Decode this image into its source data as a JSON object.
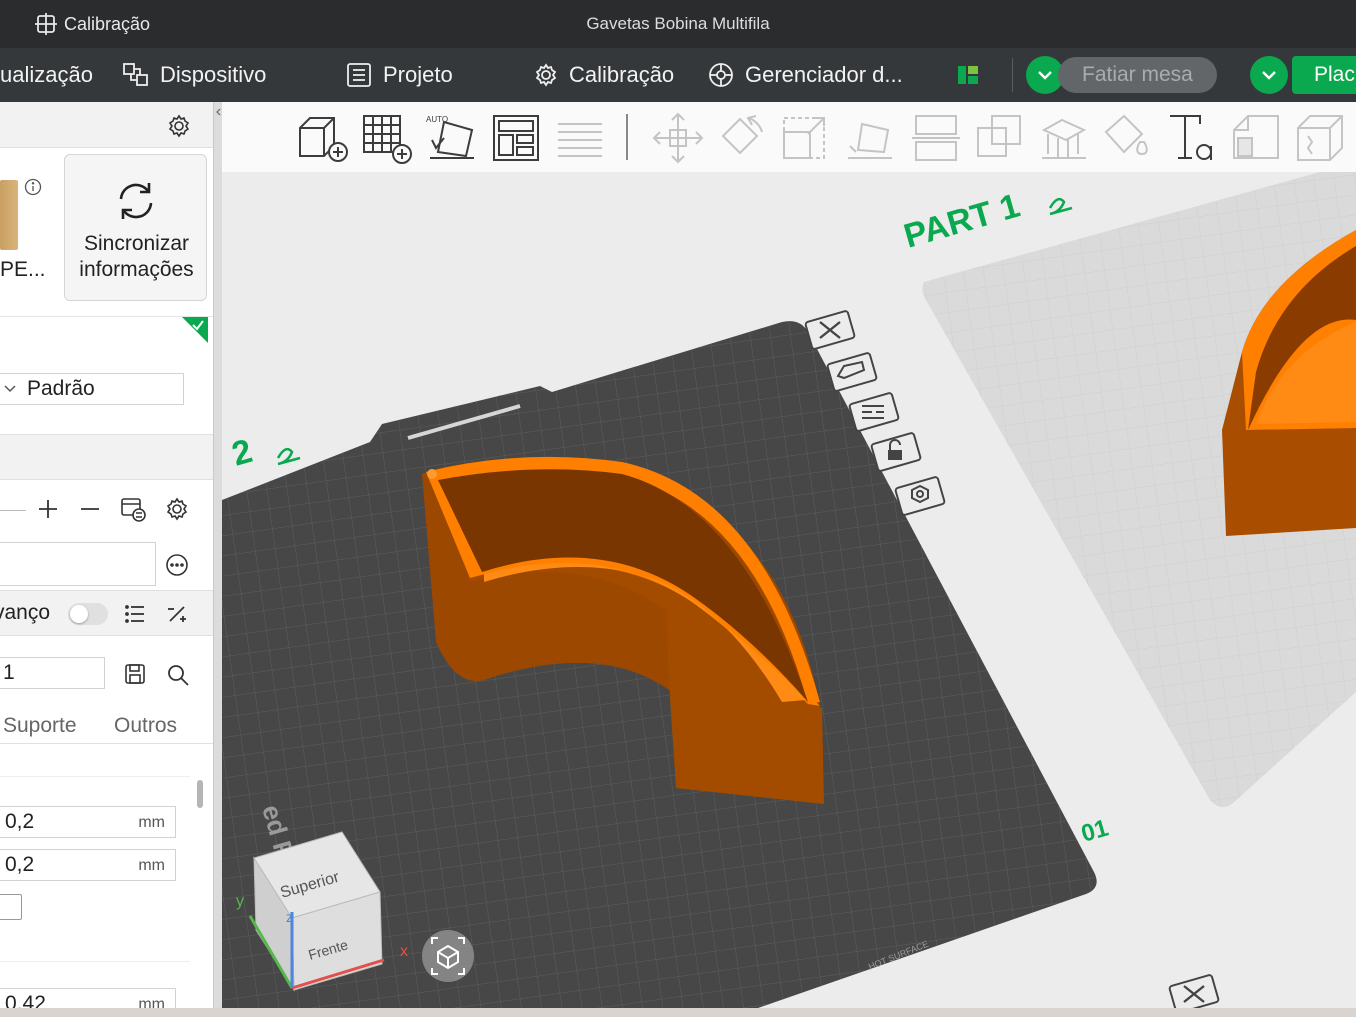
{
  "titlebar": {
    "app_label": "Calibração",
    "document_title": "Gavetas Bobina Multifila"
  },
  "menubar": {
    "items": [
      {
        "label": "ualização",
        "icon": "preview-icon"
      },
      {
        "label": "Dispositivo",
        "icon": "device-icon"
      },
      {
        "label": "Projeto",
        "icon": "project-list-icon"
      },
      {
        "label": "Calibração",
        "icon": "calibration-gear-icon"
      },
      {
        "label": "Gerenciador d...",
        "icon": "manager-icon"
      }
    ],
    "slice_button": "Fatiar mesa",
    "plate_button": "Plac",
    "accent": "#0aa84f"
  },
  "leftpanel": {
    "filament_card_label": "PE...",
    "sync_card": {
      "line1": "Sincronizar",
      "line2": "informações"
    },
    "profile_select": "Padrão",
    "advanced_label": "vanço",
    "preset_field": "1",
    "tabs": [
      "Suporte",
      "Outros"
    ],
    "params": [
      {
        "value": "0,2",
        "unit": "mm"
      },
      {
        "value": "0,2",
        "unit": "mm"
      },
      {
        "value": "0,42",
        "unit": "mm"
      }
    ]
  },
  "toolbar": {
    "tools": [
      {
        "name": "add-object-icon",
        "enabled": true
      },
      {
        "name": "add-plate-icon",
        "enabled": true
      },
      {
        "name": "auto-orient-icon",
        "enabled": true
      },
      {
        "name": "arrange-icon",
        "enabled": true
      },
      {
        "name": "layers-icon",
        "enabled": false
      },
      {
        "name": "move-icon",
        "enabled": false
      },
      {
        "name": "rotate-icon",
        "enabled": false
      },
      {
        "name": "scale-icon",
        "enabled": false
      },
      {
        "name": "lay-on-face-icon",
        "enabled": false
      },
      {
        "name": "cut-icon",
        "enabled": false
      },
      {
        "name": "boolean-icon",
        "enabled": false
      },
      {
        "name": "support-paint-icon",
        "enabled": false
      },
      {
        "name": "color-paint-icon",
        "enabled": false
      },
      {
        "name": "text-icon",
        "enabled": true
      },
      {
        "name": "assembly-icon",
        "enabled": false
      },
      {
        "name": "measure-icon",
        "enabled": false
      }
    ]
  },
  "viewport": {
    "plate_labels": {
      "part1": "PART 1",
      "part2": "2",
      "plate_number": "01"
    },
    "bed_text": "ed PEI Plate",
    "bed_surface_text": "HOT SURFACE",
    "nav_cube": {
      "top": "Superior",
      "front": "Frente",
      "axis_x": "x",
      "axis_y": "y",
      "axis_z": "z"
    },
    "model_color": "#ff7f00",
    "bed_color": "#474747",
    "label_color": "#0aa84f"
  }
}
